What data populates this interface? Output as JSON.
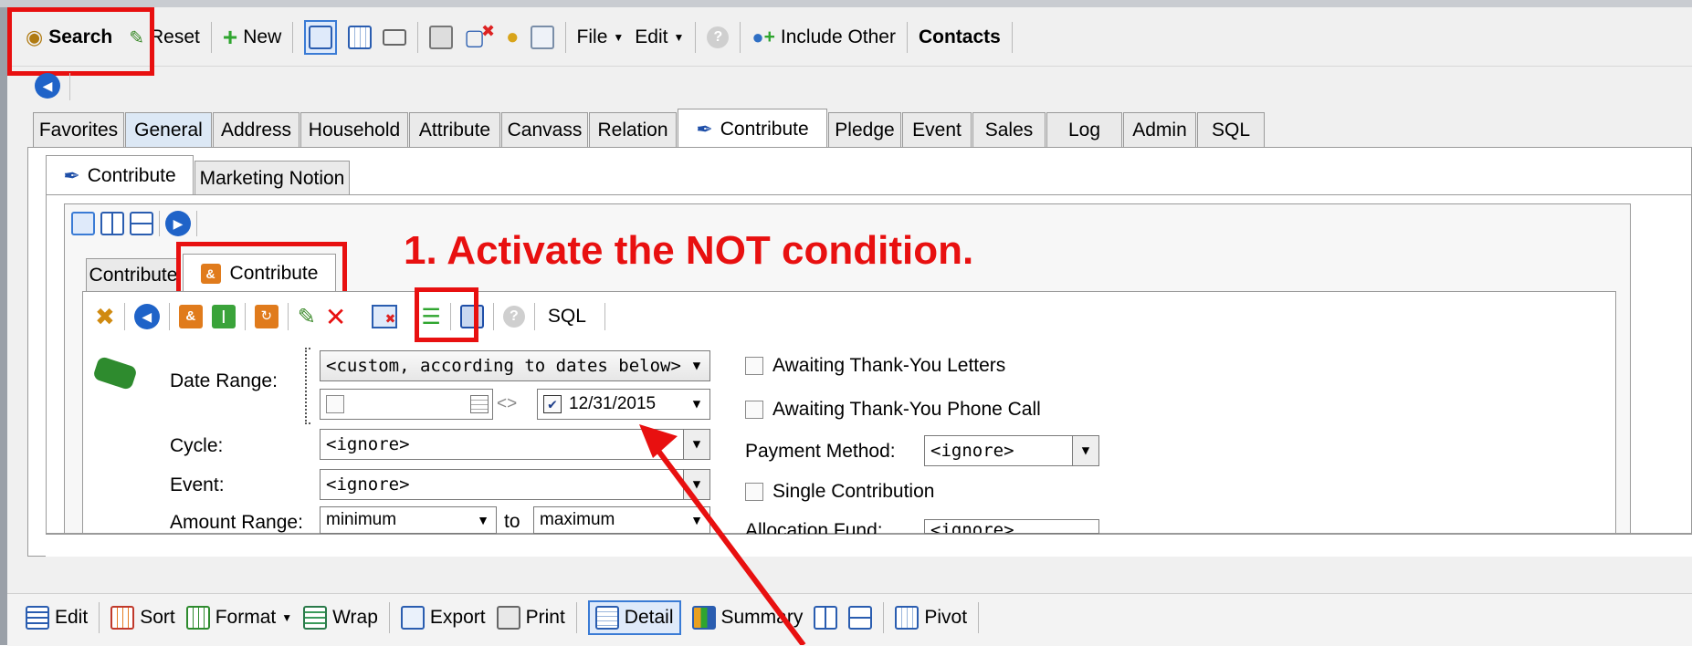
{
  "colors": {
    "highlight": "#e81010",
    "annotation": "#e81010",
    "accent": "#3a7bd5"
  },
  "toolbar": {
    "search": "Search",
    "reset": "Reset",
    "new": "New",
    "file": "File",
    "edit": "Edit",
    "include_other": "Include Other",
    "contacts": "Contacts"
  },
  "tabs": [
    "Favorites",
    "General",
    "Address",
    "Household",
    "Attribute",
    "Canvass",
    "Relation",
    "Contribute",
    "Pledge",
    "Event",
    "Sales",
    "Log",
    "Admin",
    "SQL"
  ],
  "subtabs": {
    "contribute": "Contribute",
    "marketing": "Marketing Notion"
  },
  "inner_tabs": {
    "contribute_plain": "Contribute",
    "contribute_active": "Contribute"
  },
  "inner_toolbar": {
    "sql": "SQL"
  },
  "annotation": {
    "text": "1. Activate the NOT condition."
  },
  "form": {
    "date_range_label": "Date Range:",
    "date_range_value": "<custom, according to dates below>",
    "date_from_sep": "<>",
    "date_to_value": "12/31/2015",
    "cycle_label": "Cycle:",
    "cycle_value": "<ignore>",
    "event_label": "Event:",
    "event_value": "<ignore>",
    "amount_label": "Amount Range:",
    "amount_min": "minimum",
    "amount_to": "to",
    "amount_max": "maximum",
    "awaiting_letters": "Awaiting Thank-You Letters",
    "awaiting_phone": "Awaiting Thank-You Phone Call",
    "payment_label": "Payment Method:",
    "payment_value": "<ignore>",
    "single": "Single Contribution",
    "allocation_label": "Allocation Fund:",
    "allocation_value": "<ignore>"
  },
  "bottom_toolbar": {
    "edit": "Edit",
    "sort": "Sort",
    "format": "Format",
    "wrap": "Wrap",
    "export": "Export",
    "print": "Print",
    "detail": "Detail",
    "summary": "Summary",
    "pivot": "Pivot"
  }
}
